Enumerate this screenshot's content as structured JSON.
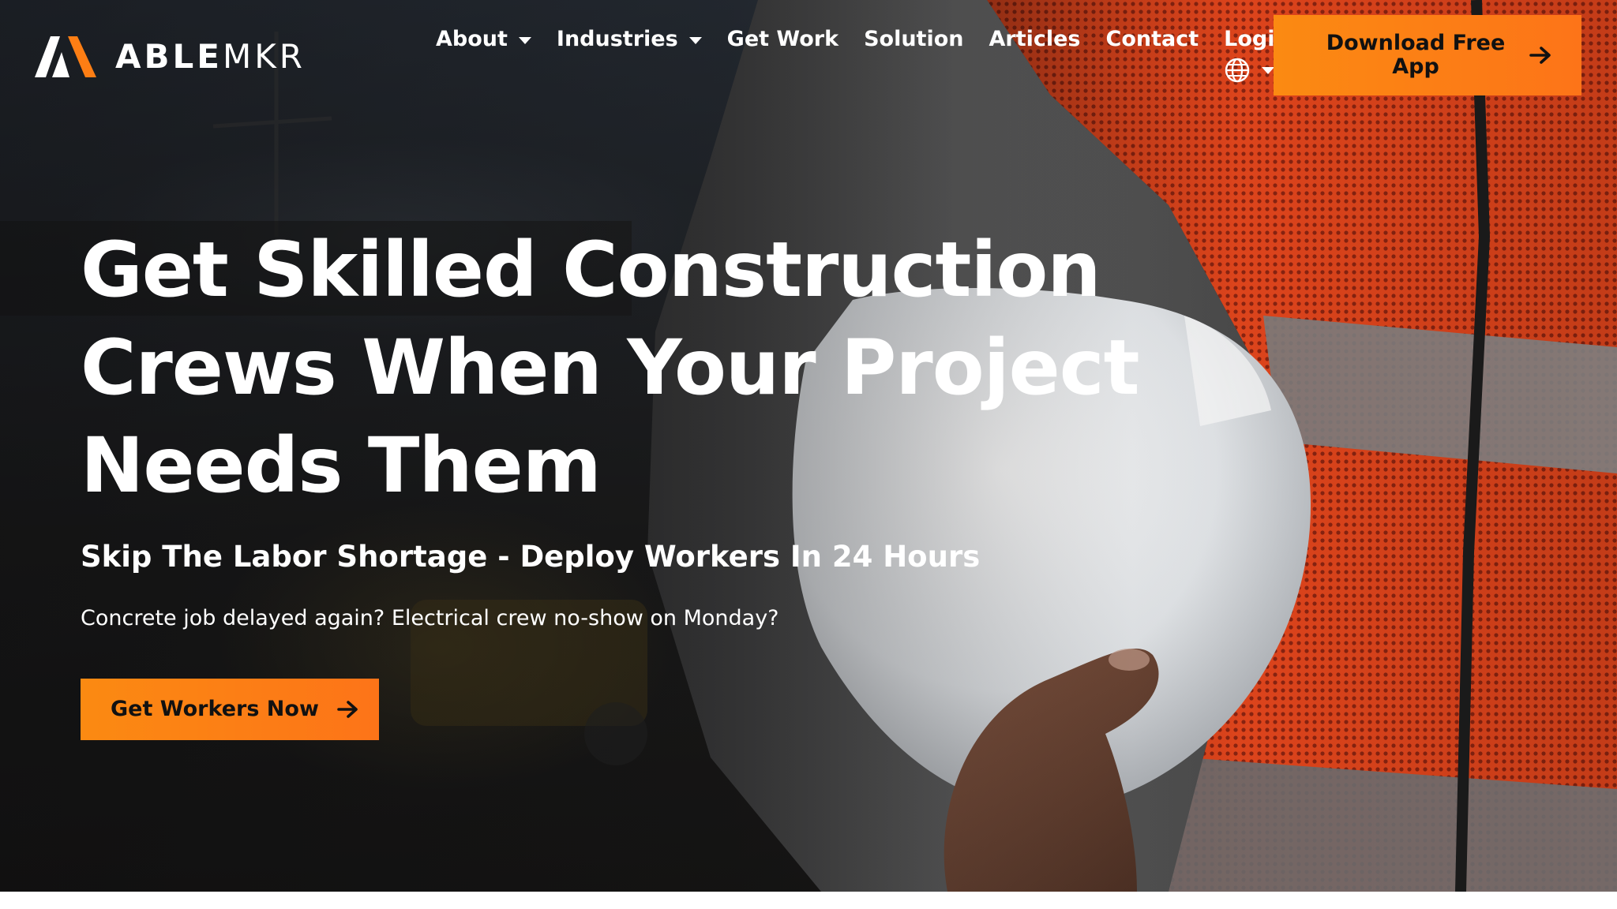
{
  "brand": {
    "name_bold": "ABLE",
    "name_light": "MKR",
    "accent": "#fd7e14",
    "accent_light": "#fb8a12"
  },
  "nav": {
    "items": [
      {
        "label": "About",
        "dropdown": true
      },
      {
        "label": "Industries",
        "dropdown": true
      },
      {
        "label": "Get Work",
        "dropdown": false
      },
      {
        "label": "Solution",
        "dropdown": false
      },
      {
        "label": "Articles",
        "dropdown": false
      },
      {
        "label": "Contact",
        "dropdown": false
      },
      {
        "label": "Login",
        "dropdown": false
      }
    ],
    "language_icon": "globe-icon"
  },
  "header_cta": {
    "label": "Download Free App",
    "icon": "arrow-right-icon"
  },
  "hero": {
    "headline": "Get Skilled Construction Crews When Your Project Needs Them",
    "subheadline": "Skip The Labor Shortage - Deploy Workers In 24 Hours",
    "body": "Concrete job delayed again? Electrical crew no-show on Monday?",
    "cta_label": "Get Workers Now",
    "cta_icon": "arrow-right-icon",
    "background_image": "construction-worker-holding-white-hard-hat-photo"
  }
}
